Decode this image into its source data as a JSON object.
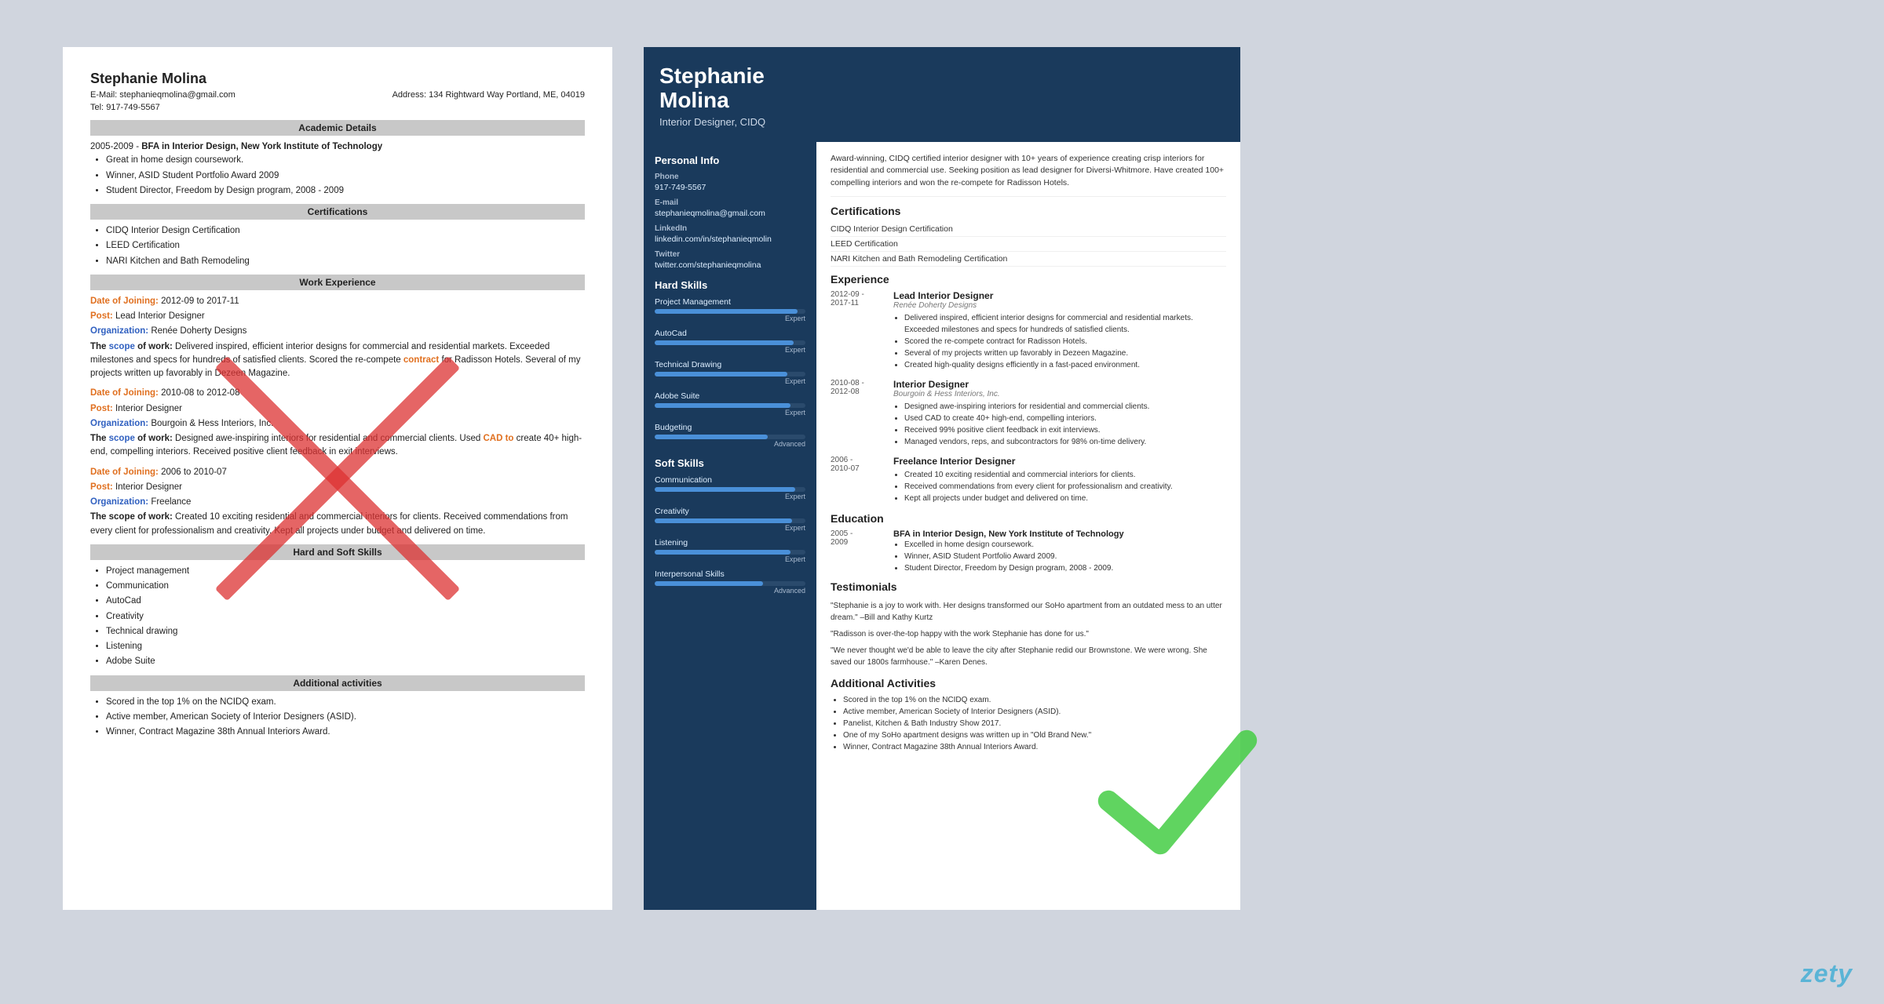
{
  "left_resume": {
    "name": "Stephanie Molina",
    "email_label": "E-Mail:",
    "email": "stephanieqmolina@gmail.com",
    "address_label": "Address:",
    "address": "134 Rightward Way Portland, ME, 04019",
    "tel_label": "Tel:",
    "tel": "917-749-5567",
    "sections": {
      "academic": {
        "header": "Academic Details",
        "entry": {
          "dates": "2005-2009 -",
          "degree": "BFA in Interior Design, New York Institute of Technology",
          "items": [
            "Great in home design coursework.",
            "Winner, ASID Student Portfolio Award 2009",
            "Student Director, Freedom by Design program, 2008 - 2009"
          ]
        }
      },
      "certifications": {
        "header": "Certifications",
        "items": [
          "CIDQ Interior Design Certification",
          "LEED Certification",
          "NARI Kitchen and Bath Remodeling"
        ]
      },
      "work_experience": {
        "header": "Work Experience",
        "entries": [
          {
            "date_label": "Date of Joining:",
            "dates": "2012-09 to 2017-11",
            "post_label": "Post:",
            "post": "Lead Interior Designer",
            "org_label": "Organization:",
            "org": "Renée Doherty Designs",
            "scope_label": "The scope of work:",
            "scope": "Delivered inspired, efficient interior designs for commercial and residential markets. Exceeded milestones and specs for hundreds of satisfied clients. Scored the re-compete contract for Radisson Hotels. Several of my projects written up favorably in Dezeen Magazine."
          },
          {
            "date_label": "Date of Joining:",
            "dates": "2010-08 to 2012-08",
            "post_label": "Post:",
            "post": "Interior Designer",
            "org_label": "Organization:",
            "org": "Bourgoin & Hess Interiors, Inc.",
            "scope_label": "The scope of work:",
            "scope": "Designed awe-inspiring interiors for residential and commercial clients. Used CAD to create 40+ high-end, compelling interiors. Received positive client feedback in exit interviews."
          },
          {
            "date_label": "Date of Joining:",
            "dates": "2006 to 2010-07",
            "post_label": "Post:",
            "post": "Interior Designer",
            "org_label": "Organization:",
            "org": "Freelance",
            "scope_label": "The scope of work:",
            "scope": "Created 10 exciting residential and commercial interiors for clients. Received commendations from every client for professionalism and creativity. Kept all projects under budget and delivered on time."
          }
        ]
      },
      "skills": {
        "header": "Hard and Soft Skills",
        "items": [
          "Project management",
          "Communication",
          "AutoCad",
          "Creativity",
          "Technical drawing",
          "Listening",
          "Adobe Suite"
        ]
      },
      "additional": {
        "header": "Additional activities",
        "items": [
          "Scored in the top 1% on the NCIDQ exam.",
          "Active member, American Society of Interior Designers (ASID).",
          "Winner, Contract Magazine 38th Annual Interiors Award."
        ]
      }
    }
  },
  "right_resume": {
    "name_line1": "Stephanie",
    "name_line2": "Molina",
    "title": "Interior Designer, CIDQ",
    "summary": "Award-winning, CIDQ certified interior designer with 10+ years of experience creating crisp interiors for residential and commercial use. Seeking position as lead designer for Diversi-Whitmore. Have created 100+ compelling interiors and won the re-compete for Radisson Hotels.",
    "sidebar": {
      "personal_info_title": "Personal Info",
      "phone_label": "Phone",
      "phone": "917-749-5567",
      "email_label": "E-mail",
      "email": "stephanieqmolina@gmail.com",
      "linkedin_label": "LinkedIn",
      "linkedin": "linkedin.com/in/stephanieqmolin",
      "twitter_label": "Twitter",
      "twitter": "twitter.com/stephanieqmolina",
      "hard_skills_title": "Hard Skills",
      "hard_skills": [
        {
          "name": "Project Management",
          "level": 95,
          "label": "Expert"
        },
        {
          "name": "AutoCad",
          "level": 92,
          "label": "Expert"
        },
        {
          "name": "Technical Drawing",
          "level": 88,
          "label": "Expert"
        },
        {
          "name": "Adobe Suite",
          "level": 90,
          "label": "Expert"
        },
        {
          "name": "Budgeting",
          "level": 75,
          "label": "Advanced"
        }
      ],
      "soft_skills_title": "Soft Skills",
      "soft_skills": [
        {
          "name": "Communication",
          "level": 93,
          "label": "Expert"
        },
        {
          "name": "Creativity",
          "level": 91,
          "label": "Expert"
        },
        {
          "name": "Listening",
          "level": 90,
          "label": "Expert"
        },
        {
          "name": "Interpersonal Skills",
          "level": 72,
          "label": "Advanced"
        }
      ]
    },
    "certifications_title": "Certifications",
    "certifications": [
      "CIDQ Interior Design Certification",
      "LEED Certification",
      "NARI Kitchen and Bath Remodeling Certification"
    ],
    "experience_title": "Experience",
    "experience": [
      {
        "dates": "2012-09 -\n2017-11",
        "title": "Lead Interior Designer",
        "company": "Renée Doherty Designs",
        "bullets": [
          "Delivered inspired, efficient interior designs for commercial and residential markets. Exceeded milestones and specs for hundreds of satisfied clients.",
          "Scored the re-compete contract for Radisson Hotels.",
          "Several of my projects written up favorably in Dezeen Magazine.",
          "Created high-quality designs efficiently in a fast-paced environment."
        ]
      },
      {
        "dates": "2010-08 -\n2012-08",
        "title": "Interior Designer",
        "company": "Bourgoin & Hess Interiors, Inc.",
        "bullets": [
          "Designed awe-inspiring interiors for residential and commercial clients.",
          "Used CAD to create 40+ high-end, compelling interiors.",
          "Received 99% positive client feedback in exit interviews.",
          "Managed vendors, reps, and subcontractors for 98% on-time delivery."
        ]
      },
      {
        "dates": "2006 -\n2010-07",
        "title": "Freelance Interior Designer",
        "company": "",
        "bullets": [
          "Created 10 exciting residential and commercial interiors for clients.",
          "Received commendations from every client for professionalism and creativity.",
          "Kept all projects under budget and delivered on time."
        ]
      }
    ],
    "education_title": "Education",
    "education": [
      {
        "dates": "2005 -\n2009",
        "title": "BFA in Interior Design, New York Institute of Technology",
        "bullets": [
          "Excelled in home design coursework.",
          "Winner, ASID Student Portfolio Award 2009.",
          "Student Director, Freedom by Design program, 2008 - 2009."
        ]
      }
    ],
    "testimonials_title": "Testimonials",
    "testimonials": [
      "\"Stephanie is a joy to work with. Her designs transformed our SoHo apartment from an outdated mess to an utter dream.\" –Bill and Kathy Kurtz",
      "\"Radisson is over-the-top happy with the work Stephanie has done for us.\"",
      "\"We never thought we'd be able to leave the city after Stephanie redid our Brownstone. We were wrong. She saved our 1800s farmhouse.\" –Karen Denes."
    ],
    "additional_title": "Additional Activities",
    "additional": [
      "Scored in the top 1% on the NCIDQ exam.",
      "Active member, American Society of Interior Designers (ASID).",
      "Panelist, Kitchen & Bath Industry Show 2017.",
      "One of my SoHo apartment designs was written up in \"Old Brand New.\"",
      "Winner, Contract Magazine 38th Annual Interiors Award."
    ]
  },
  "branding": {
    "zety": "zety"
  }
}
